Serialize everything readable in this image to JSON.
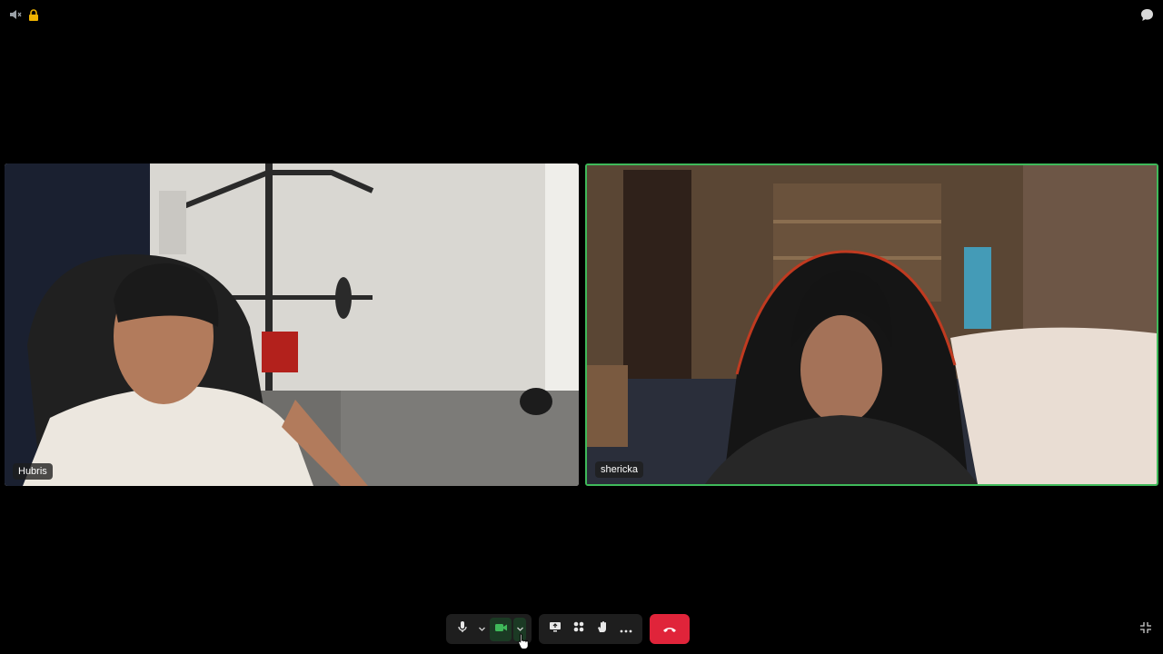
{
  "participants": [
    {
      "name": "Hubris"
    },
    {
      "name": "shericka"
    }
  ],
  "colors": {
    "background": "#000000",
    "active_speaker_border": "#3fb95a",
    "leave_button": "#e0243a",
    "camera_active": "#3fb95a"
  },
  "icons": {
    "top_left": [
      "speaker-muted-icon",
      "lock-icon"
    ],
    "top_right": "chat-icon",
    "toolbar": [
      "microphone-icon",
      "chevron-down-icon",
      "camera-icon",
      "chevron-down-icon",
      "screen-share-icon",
      "apps-icon",
      "reactions-icon",
      "more-icon",
      "hang-up-icon"
    ],
    "bottom_right": "minimize-icon"
  }
}
